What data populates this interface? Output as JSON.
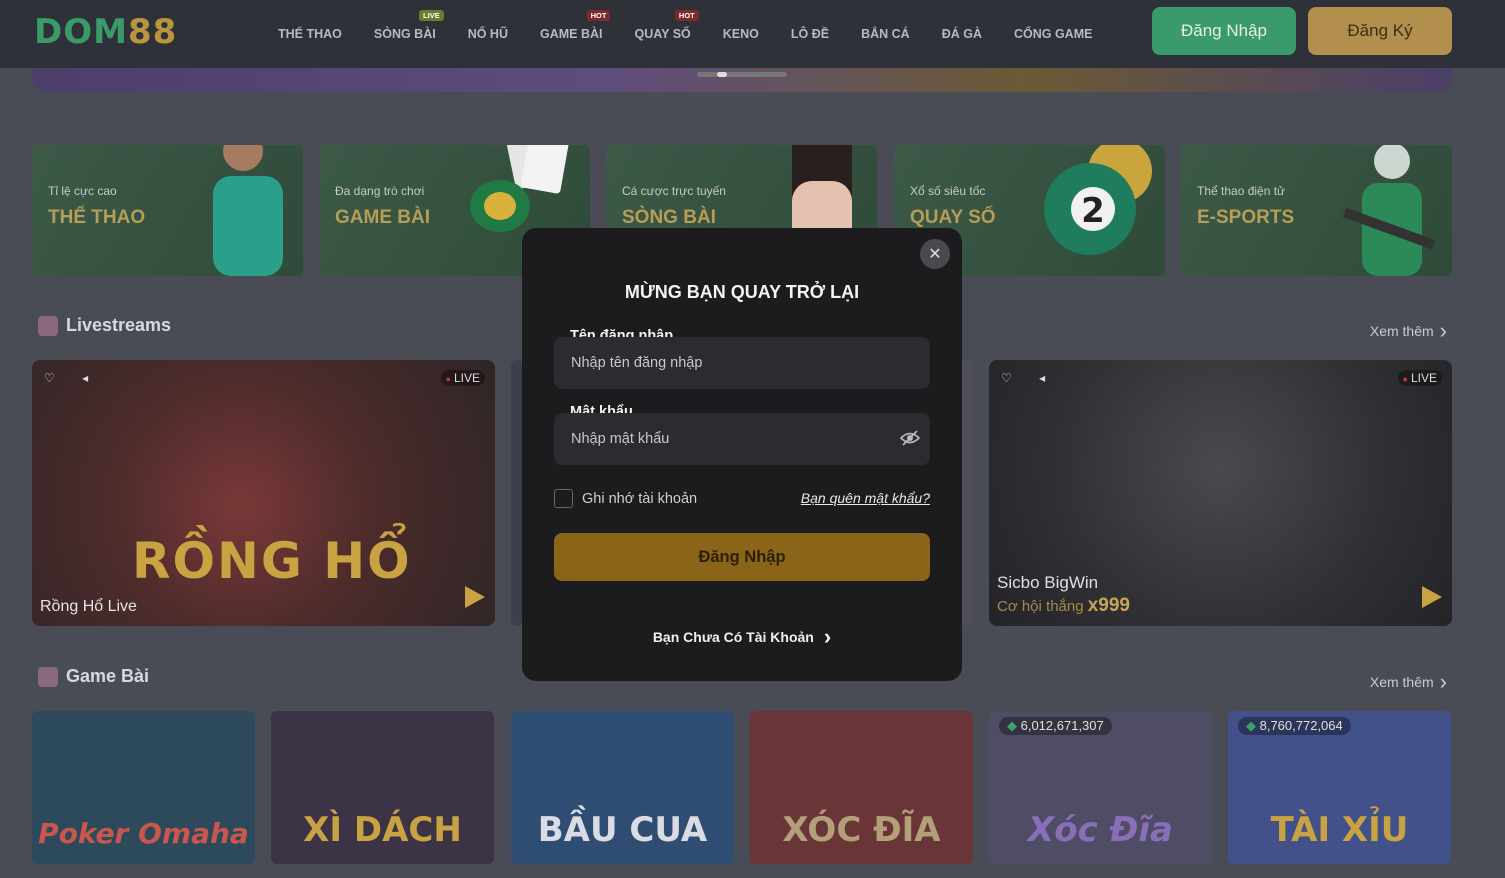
{
  "header": {
    "logo_part1": "DOM",
    "logo_part2": "88",
    "nav": [
      {
        "label": "THỂ THAO",
        "badge": ""
      },
      {
        "label": "SÒNG BÀI",
        "badge": "LIVE"
      },
      {
        "label": "NỔ HŨ",
        "badge": ""
      },
      {
        "label": "GAME BÀI",
        "badge": "HOT"
      },
      {
        "label": "QUAY SỐ",
        "badge": "HOT"
      },
      {
        "label": "KENO",
        "badge": ""
      },
      {
        "label": "LÔ ĐỀ",
        "badge": ""
      },
      {
        "label": "BẮN CÁ",
        "badge": ""
      },
      {
        "label": "ĐÁ GÀ",
        "badge": ""
      },
      {
        "label": "CỔNG GAME",
        "badge": ""
      }
    ],
    "login_label": "Đăng Nhập",
    "register_label": "Đăng Ký"
  },
  "categories": [
    {
      "sub": "Tỉ lệ cực cao",
      "title": "THỂ THAO"
    },
    {
      "sub": "Đa dạng trò chơi",
      "title": "GAME BÀI"
    },
    {
      "sub": "Cá cược trực tuyến",
      "title": "SÒNG BÀI"
    },
    {
      "sub": "Xổ số siêu tốc",
      "title": "QUAY SỐ"
    },
    {
      "sub": "Thể thao điện tử",
      "title": "E-SPORTS"
    }
  ],
  "livestreams": {
    "title": "Livestreams",
    "more": "Xem thêm",
    "cards": [
      {
        "name": "Rồng Hổ Live",
        "overlay": "RỒNG HỔ",
        "live": "LIVE"
      },
      {
        "name": "Sicbo BigWin",
        "tagline": "Cơ hội thắng",
        "multiplier": "x999",
        "live": "LIVE"
      }
    ]
  },
  "game_bai": {
    "title": "Game Bài",
    "more": "Xem thêm",
    "games": [
      {
        "art": "Poker Omaha",
        "jackpot": ""
      },
      {
        "art": "XÌ DÁCH",
        "jackpot": ""
      },
      {
        "art": "BẦU CUA",
        "jackpot": ""
      },
      {
        "art": "XÓC ĐĨA",
        "jackpot": ""
      },
      {
        "art": "Xóc Đĩa",
        "jackpot": "6,012,671,307"
      },
      {
        "art": "TÀI XỈU",
        "jackpot": "8,760,772,064"
      }
    ]
  },
  "login_modal": {
    "title": "MỪNG BẠN QUAY TRỞ LẠI",
    "username_label": "Tên đăng nhập",
    "username_placeholder": "Nhập tên đăng nhập",
    "password_label": "Mật khẩu",
    "password_placeholder": "Nhập mật khẩu",
    "remember_label": "Ghi nhớ tài khoản",
    "forgot_label": "Bạn quên mật khẩu?",
    "submit_label": "Đăng Nhập",
    "no_account_label": "Bạn Chưa Có Tài Khoản",
    "close_icon": "close-icon"
  },
  "colors": {
    "brand_green": "#3b9a6c",
    "brand_gold": "#b28f4c",
    "submit_gold": "#8a6418"
  }
}
